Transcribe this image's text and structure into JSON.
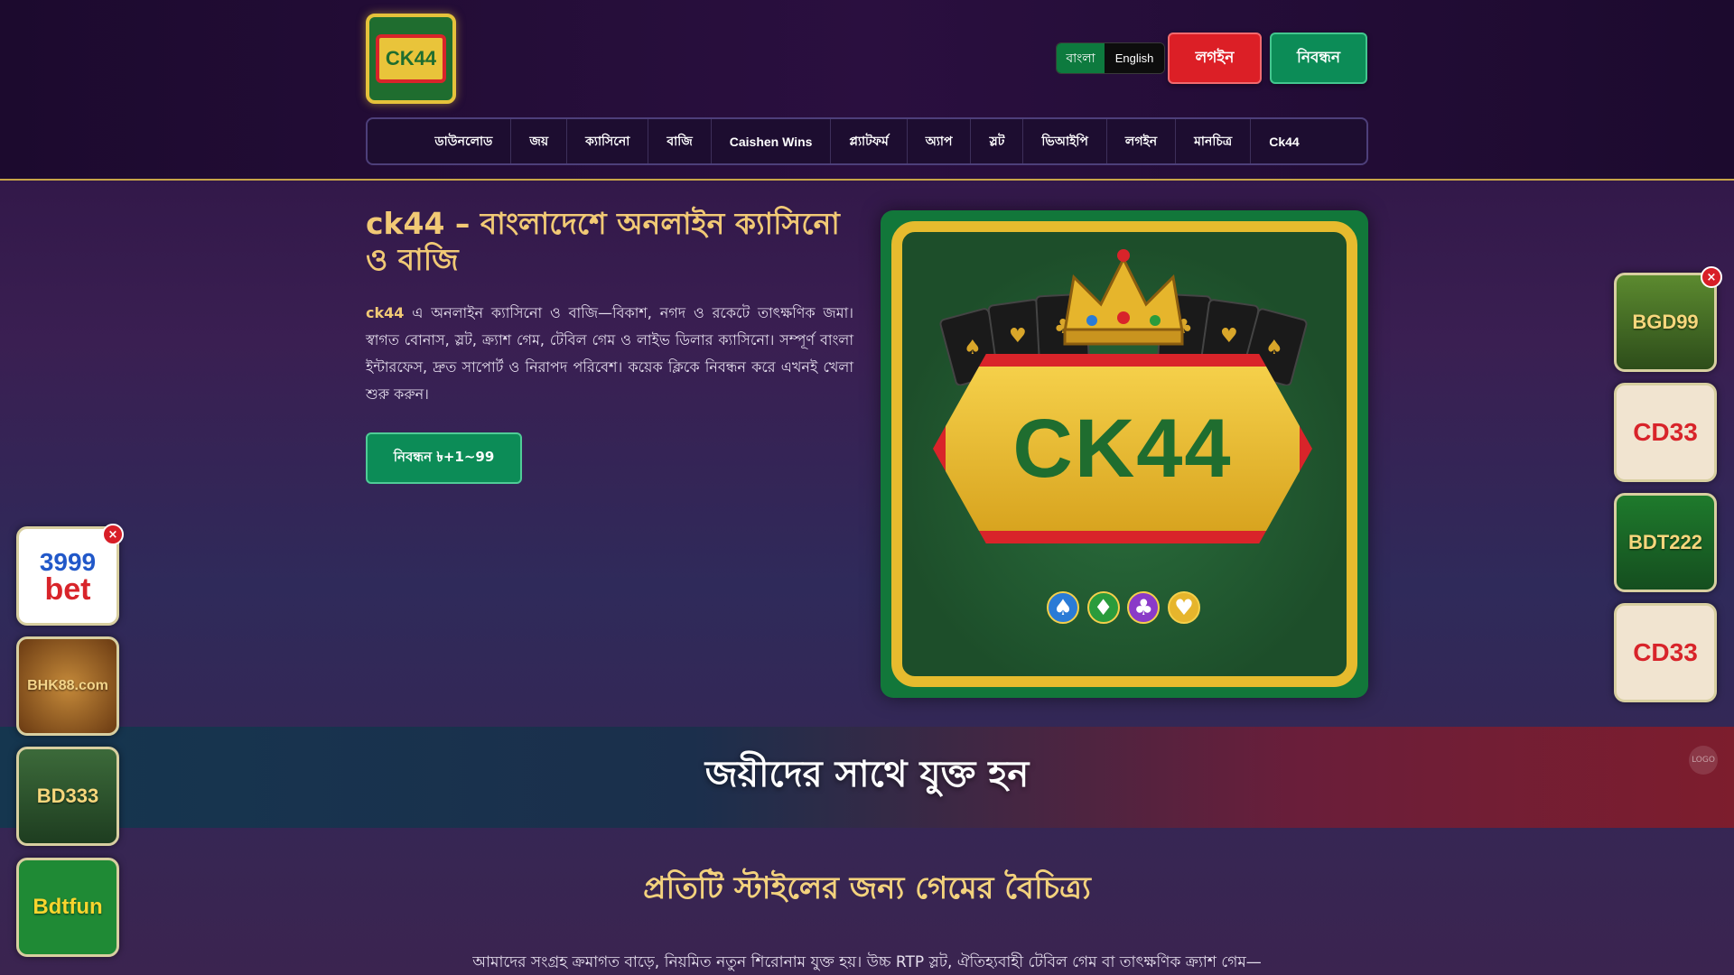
{
  "header": {
    "logo_text": "CK44",
    "languages": [
      "বাংলা",
      "English"
    ],
    "login_label": "লগইন",
    "register_label": "নিবন্ধন"
  },
  "nav": {
    "items": [
      "ডাউনলোড",
      "জয়",
      "ক্যাসিনো",
      "বাজি",
      "Caishen Wins",
      "প্ল্যাটফর্ম",
      "অ্যাপ",
      "স্লট",
      "ভিআইপি",
      "লগইন",
      "মানচিত্র",
      "Ck44"
    ]
  },
  "hero": {
    "title": "ck44 – বাংলাদেশে অনলাইন ক্যাসিনো ও বাজি",
    "brand": "ck44",
    "description": " এ অনলাইন ক্যাসিনো ও বাজি—বিকাশ, নগদ ও রকেটে তাৎক্ষণিক জমা। স্বাগত বোনাস, স্লট, ক্র্যাশ গেম, টেবিল গেম ও লাইভ ডিলার ক্যাসিনো। সম্পূর্ণ বাংলা ইন্টারফেস, দ্রুত সাপোর্ট ও নিরাপদ পরিবেশ। কয়েক ক্লিকে নিবন্ধন করে এখনই খেলা শুরু করুন।",
    "cta_label": "নিবন্ধন ৳+1~99",
    "image_text": "CK44"
  },
  "join": {
    "title": "জয়ীদের সাথে যুক্ত হন",
    "corner_icon": "LOGO"
  },
  "variety": {
    "title": "প্রতিটি স্টাইলের জন্য গেমের বৈচিত্র্য",
    "description": "আমাদের সংগ্রহ ক্রমাগত বাড়ে, নিয়মিত নতুন শিরোনাম যুক্ত হয়। উচ্চ RTP স্লট, ঐতিহ্যবাহী টেবিল গেম বা তাৎক্ষণিক ক্র্যাশ গেম—"
  },
  "ads": {
    "left": [
      {
        "line1": "3999",
        "line2": "bet"
      },
      {
        "label": "BHK88.com"
      },
      {
        "label": "BD333"
      },
      {
        "label": "Bdtfun"
      }
    ],
    "right": [
      {
        "label": "BGD99"
      },
      {
        "label": "CD33"
      },
      {
        "label": "BDT222"
      },
      {
        "label": "CD33"
      }
    ],
    "close_glyph": "×"
  },
  "colors": {
    "accent_gold": "#f1c975",
    "login_red": "#dc1f26",
    "register_green": "#0c8c57"
  }
}
